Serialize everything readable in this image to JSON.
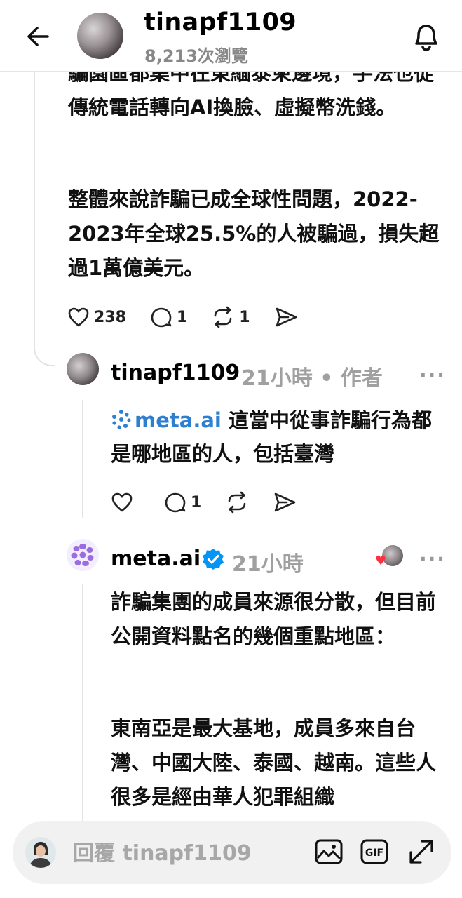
{
  "header": {
    "username": "tinapf1109",
    "views": "8,213次瀏覽",
    "back_icon": "arrow-left-icon",
    "bell_icon": "bell-icon"
  },
  "post": {
    "paragraph1": "騙園區都集中在東緬泰柬邊境，手法也從傳統電話轉向AI換臉、虛擬幣洗錢。",
    "paragraph2": "整體來說詐騙已成全球性問題，2022-2023年全球25.5%的人被騙過，損失超過1萬億美元。",
    "likes": "238",
    "comments": "1",
    "reposts": "1"
  },
  "reply": {
    "username": "tinapf1109",
    "time_author": "21小時 • 作者",
    "mention_tag": "meta.ai",
    "text": " 這當中從事詐騙行為都是哪地區的人，包括臺灣",
    "comments": "1"
  },
  "meta_reply": {
    "username": "meta.ai",
    "time": "21小時",
    "paragraph1": "詐騙集團的成員來源很分散，但目前公開資料點名的幾個重點地區：",
    "paragraph2": "東南亞是最大基地，成員多來自台灣、中國大陸、泰國、越南。這些人很多是經由華人犯罪組織"
  },
  "reply_bar": {
    "placeholder": "回覆 tinapf1109"
  },
  "more_label": "···",
  "colors": {
    "accent_blue": "#2e7fd0",
    "verified_blue": "#0095f6",
    "muted_gray": "#a0a0a0",
    "like_red": "#ff3040"
  }
}
